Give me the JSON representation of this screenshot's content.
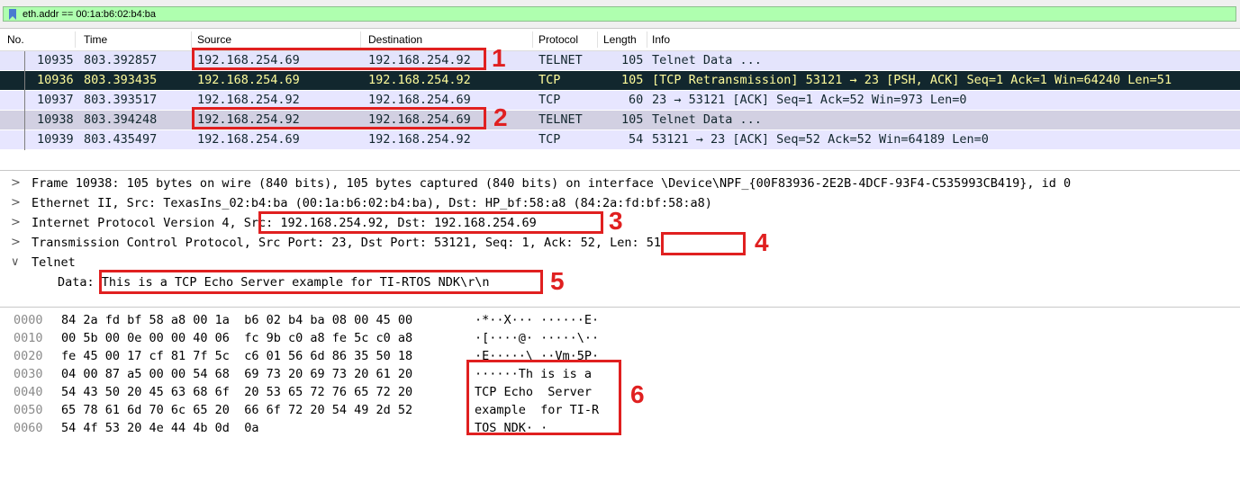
{
  "filter": {
    "text": "eth.addr == 00:1a:b6:02:b4:ba",
    "icon": "bookmark-icon"
  },
  "columns": [
    "No.",
    "Time",
    "Source",
    "Destination",
    "Protocol",
    "Length",
    "Info"
  ],
  "packets": [
    {
      "no": "10935",
      "time": "803.392857",
      "src": "192.168.254.69",
      "dst": "192.168.254.92",
      "proto": "TELNET",
      "len": "105",
      "info": "Telnet Data ..."
    },
    {
      "no": "10936",
      "time": "803.393435",
      "src": "192.168.254.69",
      "dst": "192.168.254.92",
      "proto": "TCP",
      "len": "105",
      "info": "[TCP Retransmission] 53121 → 23 [PSH, ACK] Seq=1 Ack=1 Win=64240 Len=51"
    },
    {
      "no": "10937",
      "time": "803.393517",
      "src": "192.168.254.92",
      "dst": "192.168.254.69",
      "proto": "TCP",
      "len": "60",
      "info": "23 → 53121 [ACK] Seq=1 Ack=52 Win=973 Len=0"
    },
    {
      "no": "10938",
      "time": "803.394248",
      "src": "192.168.254.92",
      "dst": "192.168.254.69",
      "proto": "TELNET",
      "len": "105",
      "info": "Telnet Data ..."
    },
    {
      "no": "10939",
      "time": "803.435497",
      "src": "192.168.254.69",
      "dst": "192.168.254.92",
      "proto": "TCP",
      "len": "54",
      "info": "53121 → 23 [ACK] Seq=52 Ack=52 Win=64189 Len=0"
    }
  ],
  "details": {
    "frame": "Frame 10938: 105 bytes on wire (840 bits), 105 bytes captured (840 bits) on interface \\Device\\NPF_{00F83936-2E2B-4DCF-93F4-C535993CB419}, id 0",
    "ethernet": "Ethernet II, Src: TexasIns_02:b4:ba (00:1a:b6:02:b4:ba), Dst: HP_bf:58:a8 (84:2a:fd:bf:58:a8)",
    "ip_prefix": "Internet Protocol Version 4, ",
    "ip_addrs": "Src: 192.168.254.92, Dst: 192.168.254.69",
    "tcp_prefix": "Transmission Control Protocol, Src Port: 23, Dst Port: 53121, Seq: 1, Ack: 52, ",
    "tcp_len": "Len: 51",
    "telnet": "Telnet",
    "data_label": "Data: ",
    "data_value": "This is a TCP Echo Server example for TI-RTOS NDK\\r\\n"
  },
  "bytes": [
    {
      "offset": "0000",
      "hex": "84 2a fd bf 58 a8 00 1a  b6 02 b4 ba 08 00 45 00",
      "ascii": "·*··X··· ······E·"
    },
    {
      "offset": "0010",
      "hex": "00 5b 00 0e 00 00 40 06  fc 9b c0 a8 fe 5c c0 a8",
      "ascii": "·[····@· ·····\\··"
    },
    {
      "offset": "0020",
      "hex": "fe 45 00 17 cf 81 7f 5c  c6 01 56 6d 86 35 50 18",
      "ascii": "·E·····\\ ··Vm·5P·"
    },
    {
      "offset": "0030",
      "hex": "04 00 87 a5 00 00 54 68  69 73 20 69 73 20 61 20",
      "ascii": "······Th is is a "
    },
    {
      "offset": "0040",
      "hex": "54 43 50 20 45 63 68 6f  20 53 65 72 76 65 72 20",
      "ascii": "TCP Echo  Server "
    },
    {
      "offset": "0050",
      "hex": "65 78 61 6d 70 6c 65 20  66 6f 72 20 54 49 2d 52",
      "ascii": "example  for TI-R"
    },
    {
      "offset": "0060",
      "hex": "54 4f 53 20 4e 44 4b 0d  0a",
      "ascii": "TOS NDK· ·"
    }
  ],
  "annotations": [
    "1",
    "2",
    "3",
    "4",
    "5",
    "6"
  ]
}
